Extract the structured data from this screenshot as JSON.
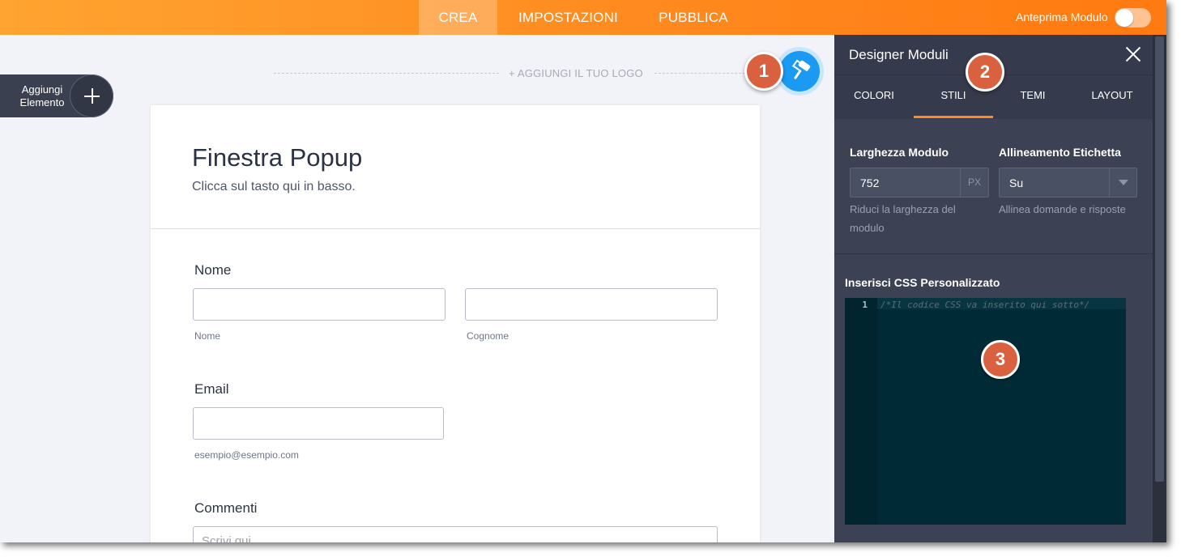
{
  "topbar": {
    "tabs": [
      {
        "label": "CREA",
        "active": true
      },
      {
        "label": "IMPOSTAZIONI",
        "active": false
      },
      {
        "label": "PUBBLICA",
        "active": false
      }
    ],
    "preview_label": "Anteprima Modulo",
    "preview_toggle_on": false
  },
  "canvas": {
    "logo_placeholder": "+ AGGIUNGI IL TUO LOGO",
    "add_element": {
      "line1": "Aggiungi",
      "line2": "Elemento",
      "icon": "plus-icon"
    },
    "paint_icon": "paint-roller-icon"
  },
  "form": {
    "title": "Finestra Popup",
    "subtitle": "Clicca sul tasto qui in basso.",
    "fields": {
      "name": {
        "label": "Nome",
        "first_sub": "Nome",
        "last_sub": "Cognome"
      },
      "email": {
        "label": "Email",
        "sub": "esempio@esempio.com"
      },
      "comments": {
        "label": "Commenti",
        "placeholder": "Scrivi qui..."
      }
    }
  },
  "badges": [
    "1",
    "2",
    "3"
  ],
  "panel": {
    "title": "Designer Moduli",
    "close_icon": "close-icon",
    "tabs": [
      {
        "label": "COLORI",
        "active": false
      },
      {
        "label": "STILI",
        "active": true
      },
      {
        "label": "TEMI",
        "active": false
      },
      {
        "label": "LAYOUT",
        "active": false
      }
    ],
    "width": {
      "label": "Larghezza Modulo",
      "value": "752",
      "unit": "PX",
      "help_line1": "Riduci la larghezza del",
      "help_line2": "modulo"
    },
    "align": {
      "label": "Allineamento Etichetta",
      "value": "Su",
      "help": "Allinea domande e risposte"
    },
    "css": {
      "label": "Inserisci CSS Personalizzato",
      "line_number": "1",
      "code": "/*Il codice CSS va inserito qui sotto*/"
    }
  },
  "colors": {
    "accent_orange": "#ff8a1f",
    "panel_bg": "#3c4254",
    "badge": "#d9613f",
    "paint_button": "#1a9af2",
    "code_bg": "#002b36"
  }
}
